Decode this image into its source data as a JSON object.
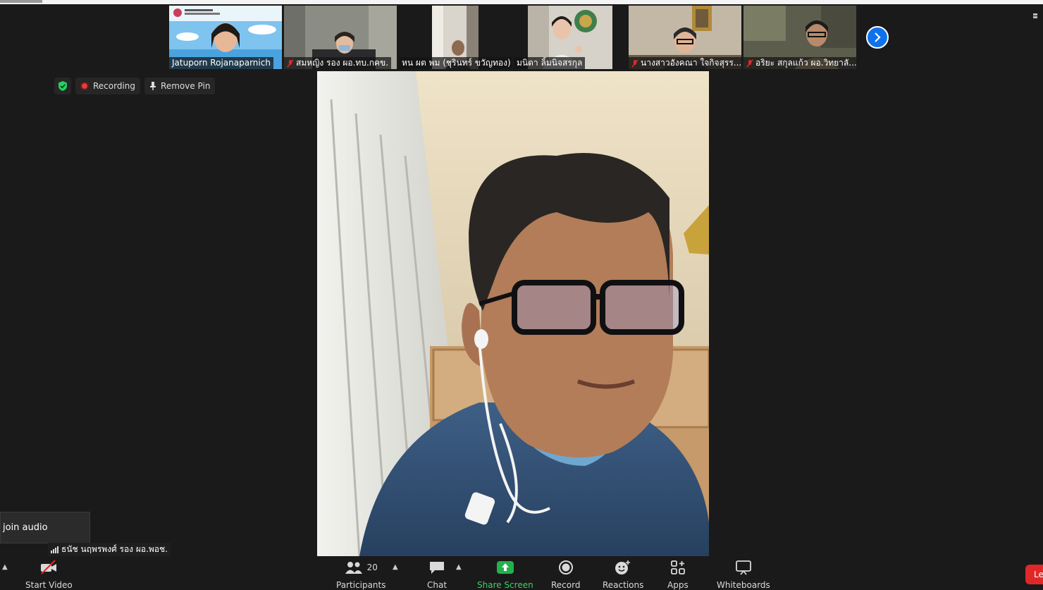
{
  "thumbnails": [
    {
      "name": "Jatuporn Rojanaparnich",
      "muted": false
    },
    {
      "name": "สมหญิง รอง ผอ.ทบ.กคข.",
      "muted": true
    },
    {
      "name": "หน ผต พม (ชุรินทร์ ขวัญทอง)",
      "muted": false
    },
    {
      "name": "มนิดา ลิ้มนิจสรกุล",
      "muted": false
    },
    {
      "name": "นางสาวอังคณา ใจกิจสุรร...",
      "muted": true
    },
    {
      "name": "อริยะ สกุลแก้ว ผอ.วิทยาลั...",
      "muted": true
    }
  ],
  "indicators": {
    "recording_label": "Recording",
    "remove_pin_label": "Remove Pin"
  },
  "join_audio_label": "join audio",
  "self_name": "ธนัช นฤพรพงศ์ รอง ผอ.พอช.",
  "toolbar": {
    "start_video": "Start Video",
    "participants": "Participants",
    "participants_count": "20",
    "chat": "Chat",
    "share_screen": "Share Screen",
    "record": "Record",
    "reactions": "Reactions",
    "apps": "Apps",
    "whiteboards": "Whiteboards",
    "leave": "Le"
  },
  "colors": {
    "background": "#1a1a1a",
    "accent_blue": "#0e72ed",
    "share_green": "#23b14d",
    "recording_red": "#e43c3c",
    "leave_red": "#e02828",
    "secure_green": "#23d160"
  }
}
